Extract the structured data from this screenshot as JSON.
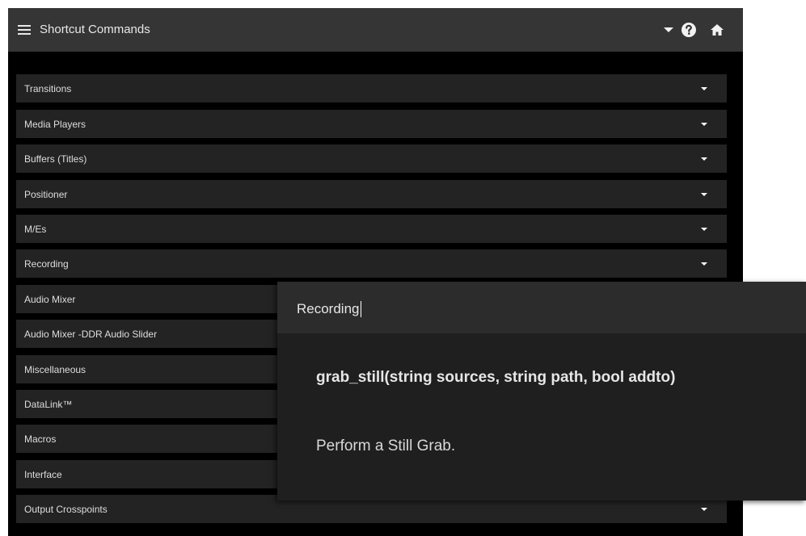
{
  "header": {
    "title": "Shortcut Commands",
    "icons": [
      "menu-icon",
      "dropdown-icon",
      "help-icon",
      "home-icon"
    ]
  },
  "sections": [
    {
      "label": "Transitions"
    },
    {
      "label": "Media Players"
    },
    {
      "label": "Buffers (Titles)"
    },
    {
      "label": "Positioner"
    },
    {
      "label": "M/Es"
    },
    {
      "label": "Recording"
    },
    {
      "label": "Audio Mixer"
    },
    {
      "label": "Audio Mixer -DDR Audio Slider"
    },
    {
      "label": "Miscellaneous"
    },
    {
      "label": "DataLink™"
    },
    {
      "label": "Macros"
    },
    {
      "label": "Interface"
    },
    {
      "label": "Output Crosspoints"
    }
  ],
  "popup": {
    "title": "Recording",
    "signature": "grab_still(string sources, string path, bool addto)",
    "description": "Perform a Still Grab."
  },
  "colors": {
    "topbar": "#353535",
    "background": "#000000",
    "row": "#232323",
    "popup": "#1f1f1f",
    "popup_header": "#2c2c2c",
    "text": "#e8e8e8"
  }
}
